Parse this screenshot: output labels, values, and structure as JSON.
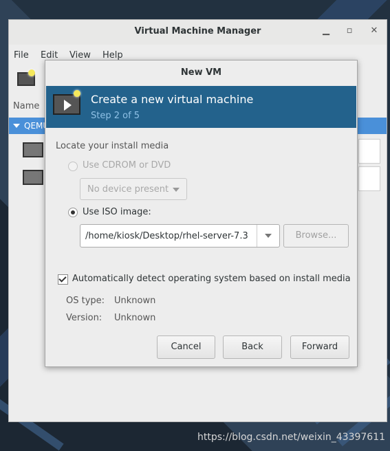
{
  "main_window": {
    "title": "Virtual Machine Manager",
    "menu": [
      "File",
      "Edit",
      "View",
      "Help"
    ],
    "list_header": "Name",
    "connection_label": "QEMU"
  },
  "dialog": {
    "title": "New VM",
    "header_title": "Create a new virtual machine",
    "header_step": "Step 2 of 5",
    "section_label": "Locate your install media",
    "option_cdrom": "Use CDROM or DVD",
    "cdrom_placeholder": "No device present",
    "option_iso": "Use ISO image:",
    "iso_path": "/home/kiosk/Desktop/rhel-server-7.3",
    "browse_label": "Browse...",
    "auto_detect_label": "Automatically detect operating system based on install media",
    "auto_detect_checked": true,
    "os_type_key": "OS type:",
    "os_type_value": "Unknown",
    "version_key": "Version:",
    "version_value": "Unknown",
    "cancel_label": "Cancel",
    "back_label": "Back",
    "forward_label": "Forward"
  },
  "watermark": "https://blog.csdn.net/weixin_43397611",
  "colors": {
    "header_band": "#23628c",
    "selection": "#4a90d9"
  }
}
